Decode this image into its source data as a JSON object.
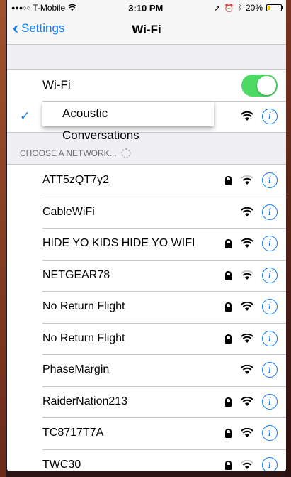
{
  "status_bar": {
    "signal": "●●●○○",
    "carrier": "T-Mobile",
    "time": "3:10 PM",
    "battery": "20%",
    "battery_level": 0.2
  },
  "nav": {
    "back_label": "Settings",
    "title": "Wi-Fi"
  },
  "wifi_toggle": {
    "label": "Wi-Fi",
    "on": true
  },
  "connected": {
    "name_line1": "Acoustic",
    "name_line2": "Conversations"
  },
  "section_header": "CHOOSE A NETWORK...",
  "networks": [
    {
      "name": "ATT5zQT7y2",
      "locked": true
    },
    {
      "name": "CableWiFi",
      "locked": false
    },
    {
      "name": "HIDE YO KIDS HIDE YO WIFI",
      "locked": true
    },
    {
      "name": "NETGEAR78",
      "locked": true
    },
    {
      "name": "No Return Flight",
      "locked": true
    },
    {
      "name": "No Return Flight",
      "locked": true
    },
    {
      "name": "PhaseMargin",
      "locked": false
    },
    {
      "name": "RaiderNation213",
      "locked": true
    },
    {
      "name": "TC8717T7A",
      "locked": true
    },
    {
      "name": "TWC30",
      "locked": true
    }
  ],
  "colors": {
    "accent": "#0a7aff",
    "toggle_on": "#4cd964",
    "battery": "#f4c300"
  },
  "icons": {
    "wifi": "wifi-icon",
    "lock": "lock-icon",
    "info": "info-icon",
    "check": "checkmark-icon"
  }
}
